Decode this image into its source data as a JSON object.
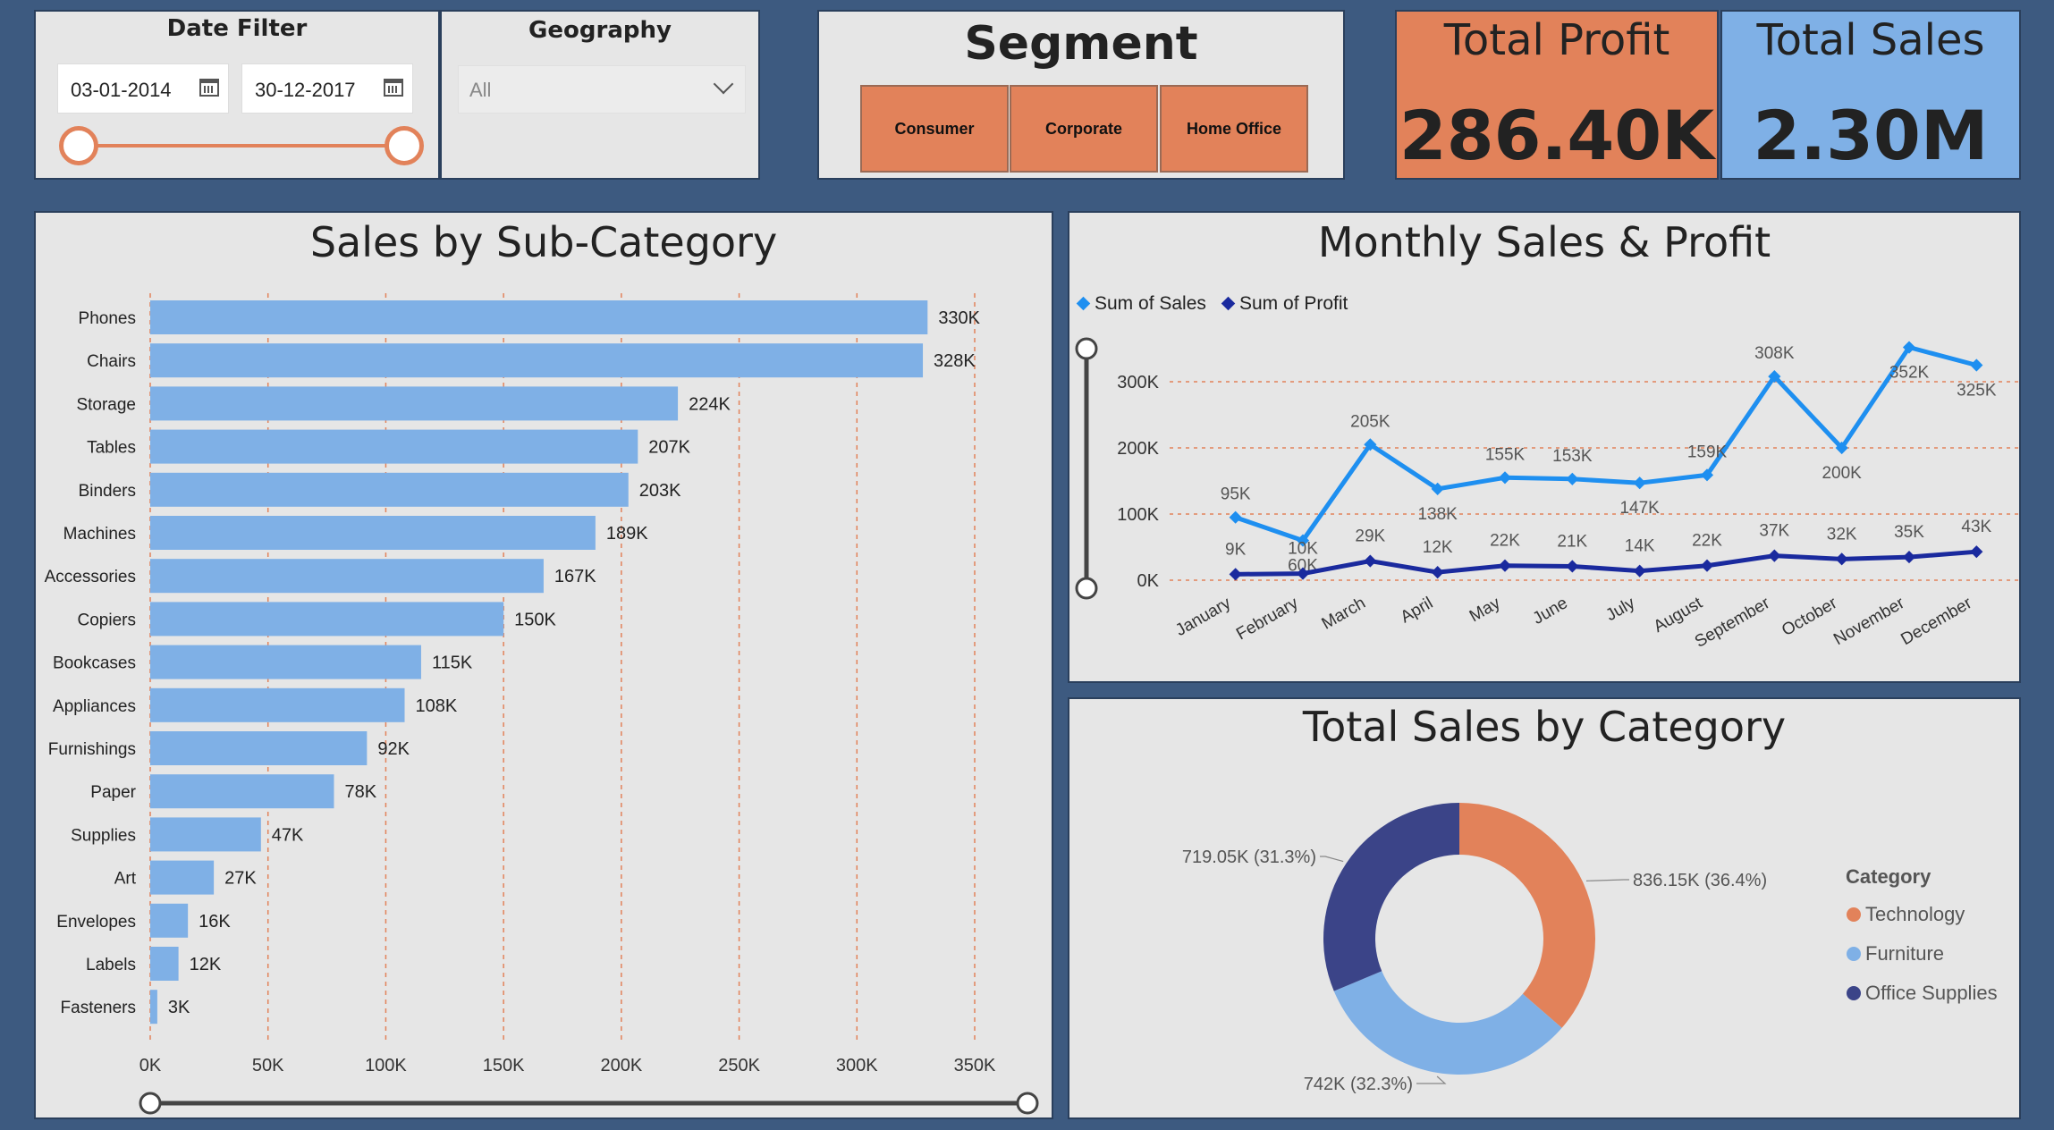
{
  "date_filter": {
    "title": "Date Filter",
    "start": "03-01-2014",
    "end": "30-12-2017"
  },
  "geography": {
    "title": "Geography",
    "selected": "All"
  },
  "segment": {
    "title": "Segment",
    "buttons": [
      "Consumer",
      "Corporate",
      "Home Office"
    ]
  },
  "kpis": {
    "profit_label": "Total Profit",
    "profit_value": "286.40K",
    "sales_label": "Total Sales",
    "sales_value": "2.30M"
  },
  "colors": {
    "orange": "#e2825a",
    "light_blue": "#7fb0e6",
    "navy": "#3b4488",
    "line_sales": "#1e8ff0",
    "line_profit": "#1a2a9e",
    "background": "#3d5a80"
  },
  "charts": {
    "subcat_title": "Sales by Sub-Category",
    "monthly_title": "Monthly Sales & Profit",
    "category_title": "Total Sales by Category"
  },
  "chart_data": [
    {
      "type": "bar",
      "title": "Sales by Sub-Category",
      "orientation": "horizontal",
      "categories": [
        "Phones",
        "Chairs",
        "Storage",
        "Tables",
        "Binders",
        "Machines",
        "Accessories",
        "Copiers",
        "Bookcases",
        "Appliances",
        "Furnishings",
        "Paper",
        "Supplies",
        "Art",
        "Envelopes",
        "Labels",
        "Fasteners"
      ],
      "values": [
        330,
        328,
        224,
        207,
        203,
        189,
        167,
        150,
        115,
        108,
        92,
        78,
        47,
        27,
        16,
        12,
        3
      ],
      "value_labels": [
        "330K",
        "328K",
        "224K",
        "207K",
        "203K",
        "189K",
        "167K",
        "150K",
        "115K",
        "108K",
        "92K",
        "78K",
        "47K",
        "27K",
        "16K",
        "12K",
        "3K"
      ],
      "unit": "K",
      "xlim": [
        0,
        350
      ],
      "xticks": [
        0,
        50,
        100,
        150,
        200,
        250,
        300,
        350
      ],
      "xtick_labels": [
        "0K",
        "50K",
        "100K",
        "150K",
        "200K",
        "250K",
        "300K",
        "350K"
      ],
      "grid": true
    },
    {
      "type": "line",
      "title": "Monthly Sales & Profit",
      "legend_position": "top-left",
      "x": [
        "January",
        "February",
        "March",
        "April",
        "May",
        "June",
        "July",
        "August",
        "September",
        "October",
        "November",
        "December"
      ],
      "series": [
        {
          "name": "Sum of Sales",
          "values": [
            95,
            60,
            205,
            138,
            155,
            153,
            147,
            159,
            308,
            200,
            352,
            325
          ],
          "labels": [
            "95K",
            "60K",
            "205K",
            "138K",
            "155K",
            "153K",
            "147K",
            "159K",
            "308K",
            "200K",
            "352K",
            "325K"
          ]
        },
        {
          "name": "Sum of Profit",
          "values": [
            9,
            10,
            29,
            12,
            22,
            21,
            14,
            22,
            37,
            32,
            35,
            43
          ],
          "labels": [
            "9K",
            "10K",
            "29K",
            "12K",
            "22K",
            "21K",
            "14K",
            "22K",
            "37K",
            "32K",
            "35K",
            "43K"
          ]
        }
      ],
      "unit": "K",
      "ylim": [
        0,
        300
      ],
      "yticks": [
        0,
        100,
        200,
        300
      ],
      "ytick_labels": [
        "0K",
        "100K",
        "200K",
        "300K"
      ],
      "grid": true
    },
    {
      "type": "pie",
      "variant": "donut",
      "title": "Total Sales by Category",
      "legend_title": "Category",
      "legend_position": "right",
      "slices": [
        {
          "name": "Technology",
          "value": 836.15,
          "label": "836.15K (36.4%)",
          "color": "#e2825a"
        },
        {
          "name": "Furniture",
          "value": 742,
          "label": "742K (32.3%)",
          "color": "#7fb0e6"
        },
        {
          "name": "Office Supplies",
          "value": 719.05,
          "label": "719.05K (31.3%)",
          "color": "#3b4488"
        }
      ]
    }
  ]
}
